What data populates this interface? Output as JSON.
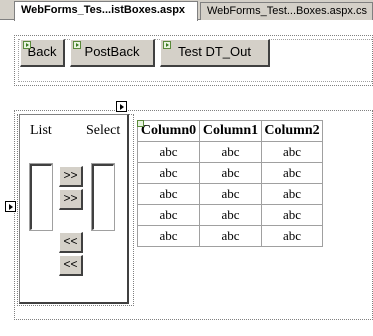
{
  "tabs": [
    {
      "label": "WebForms_Tes...istBoxes.aspx",
      "active": true
    },
    {
      "label": "WebForms_Test...Boxes.aspx.cs",
      "active": false
    }
  ],
  "toolbar": {
    "back_label": "Back",
    "postback_label": "PostBack",
    "test_dt_label": "Test DT_Out"
  },
  "listpanel": {
    "list_label": "List",
    "select_label": "Select",
    "move_buttons": [
      ">>",
      ">>",
      "<<",
      "<<"
    ]
  },
  "grid": {
    "columns": [
      "Column0",
      "Column1",
      "Column2"
    ],
    "rows": [
      [
        "abc",
        "abc",
        "abc"
      ],
      [
        "abc",
        "abc",
        "abc"
      ],
      [
        "abc",
        "abc",
        "abc"
      ],
      [
        "abc",
        "abc",
        "abc"
      ],
      [
        "abc",
        "abc",
        "abc"
      ]
    ]
  },
  "colors": {
    "chrome": "#d4d0c8",
    "border_dark": "#404040",
    "border_mid": "#808080",
    "canvas": "#ffffff"
  }
}
